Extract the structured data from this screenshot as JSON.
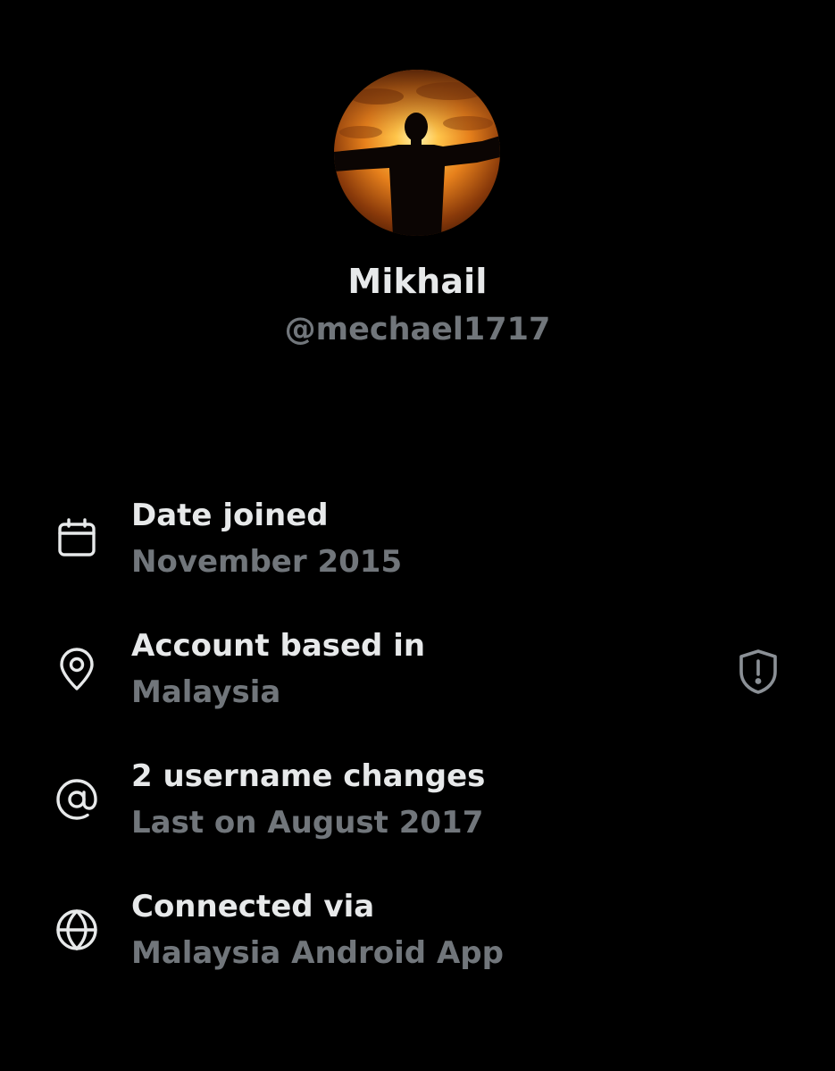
{
  "profile": {
    "display_name": "Mikhail",
    "handle": "@mechael1717"
  },
  "info": [
    {
      "icon": "calendar-icon",
      "title": "Date joined",
      "value": "November 2015"
    },
    {
      "icon": "location-pin-icon",
      "title": "Account based in",
      "value": "Malaysia",
      "badge_icon": "shield-alert-icon"
    },
    {
      "icon": "at-sign-icon",
      "title": "2 username changes",
      "value": "Last on August 2017"
    },
    {
      "icon": "globe-icon",
      "title": "Connected via",
      "value": "Malaysia Android App"
    }
  ],
  "colors": {
    "background": "#000000",
    "primary_text": "#e7e9ea",
    "secondary_text": "#71767b"
  }
}
